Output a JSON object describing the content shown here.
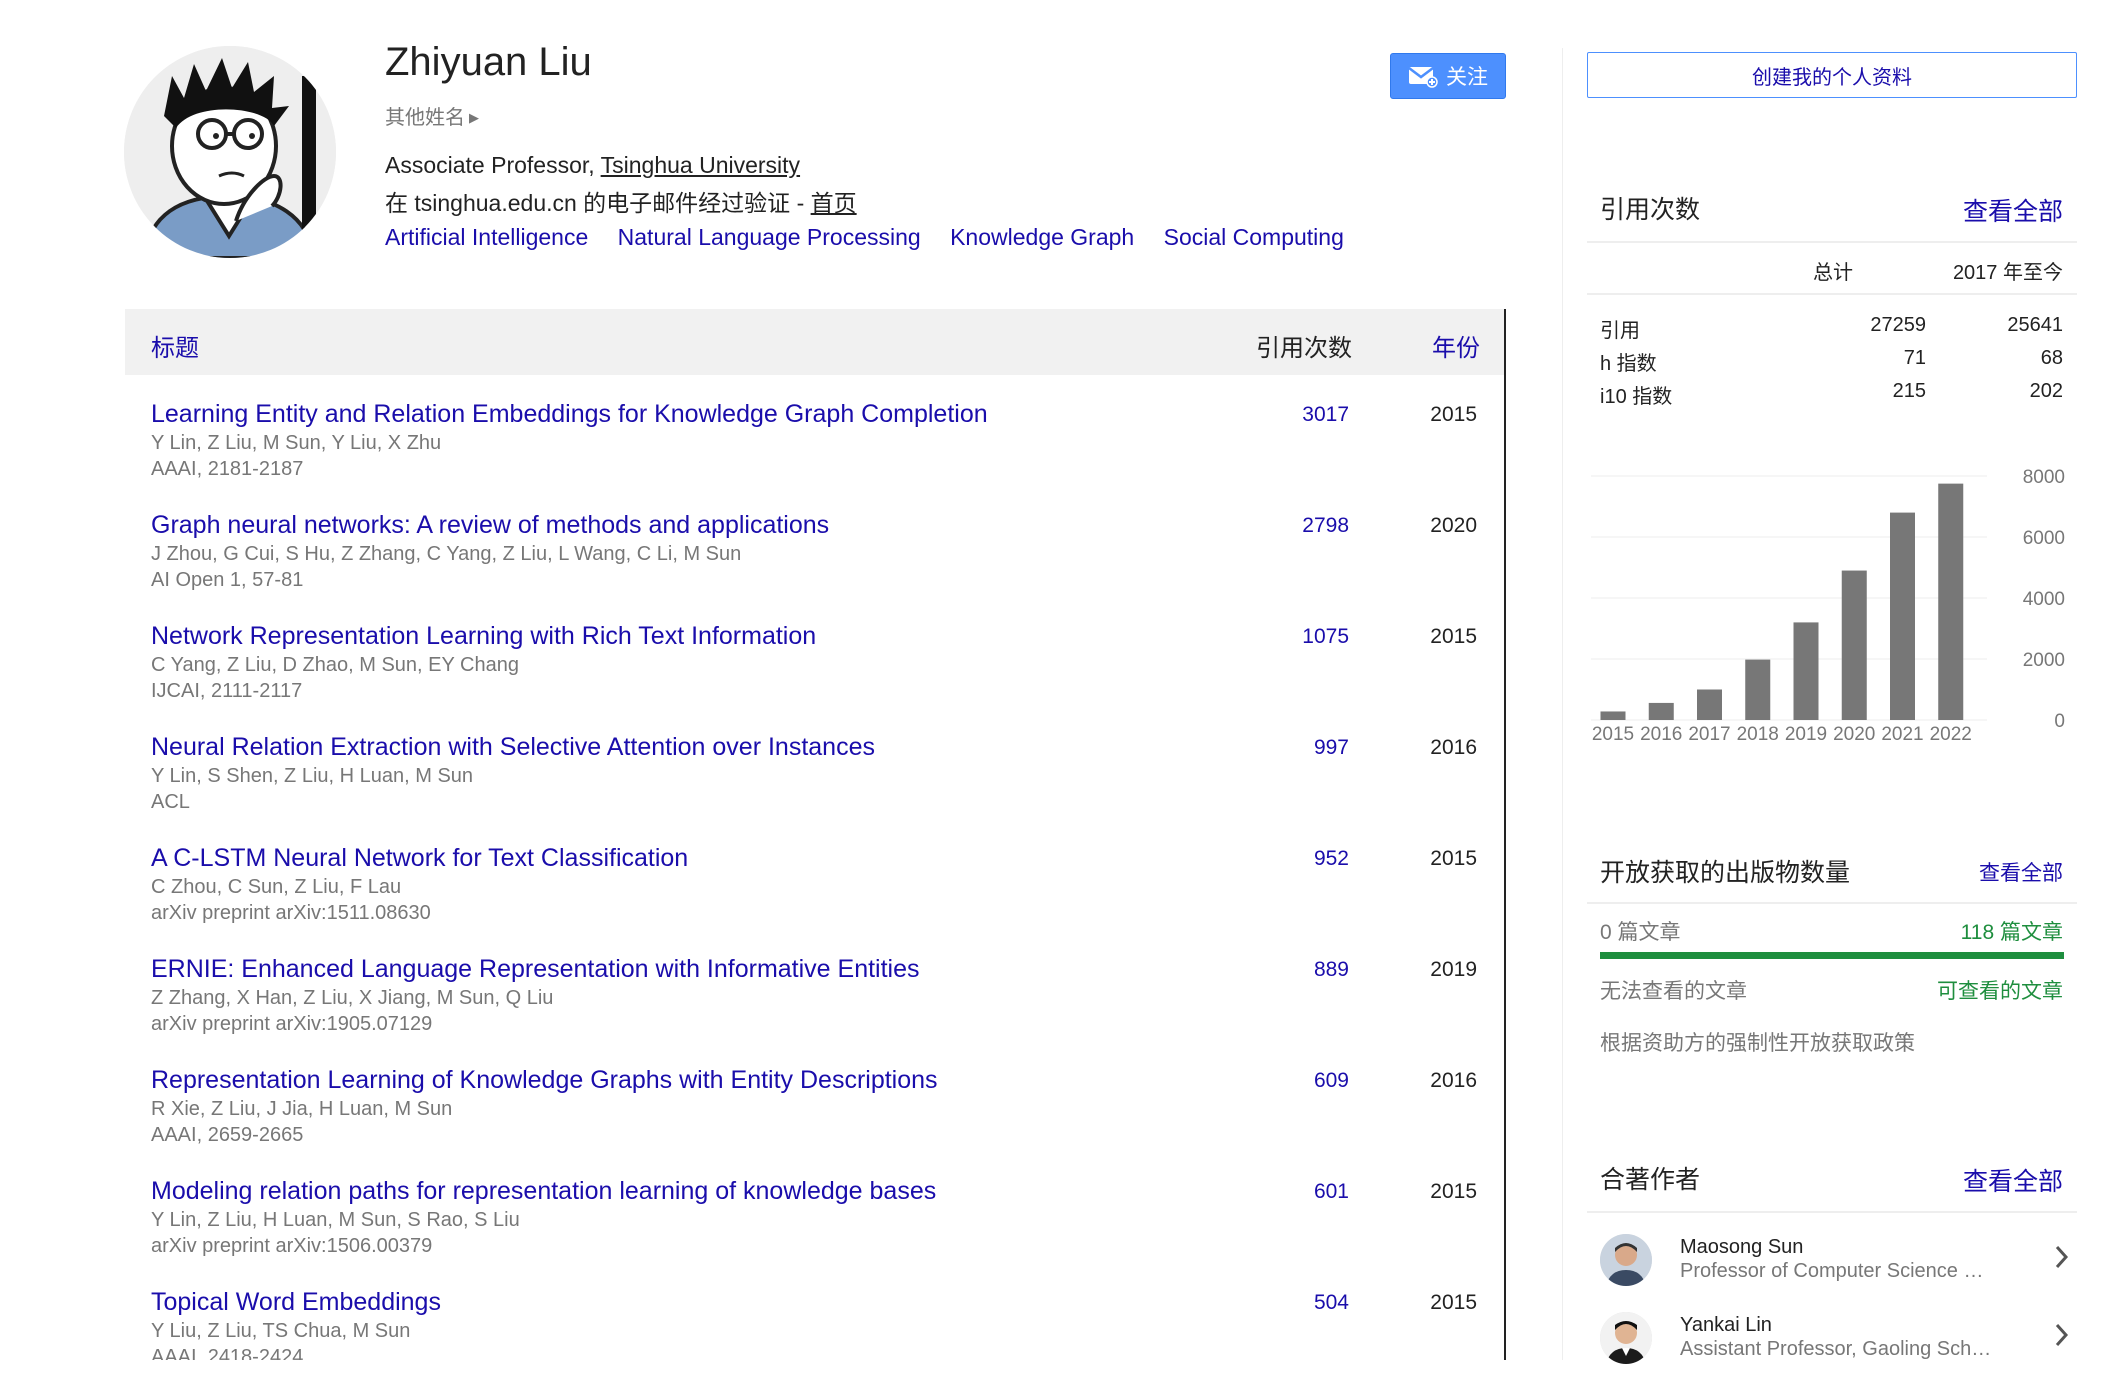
{
  "profile": {
    "name": "Zhiyuan Liu",
    "other_names": "其他姓名",
    "affiliation_prefix": "Associate Professor, ",
    "affiliation_link": "Tsinghua University",
    "verified_text": "在 tsinghua.edu.cn 的电子邮件经过验证 - ",
    "homepage_link": "首页",
    "interests": [
      "Artificial Intelligence",
      "Natural Language Processing",
      "Knowledge Graph",
      "Social Computing"
    ],
    "follow_label": "关注"
  },
  "table": {
    "headers": {
      "title": "标题",
      "cited_by": "引用次数",
      "year": "年份"
    },
    "rows": [
      {
        "title": "Learning Entity and Relation Embeddings for Knowledge Graph Completion",
        "authors": "Y Lin, Z Liu, M Sun, Y Liu, X Zhu",
        "venue": "AAAI, 2181-2187",
        "cites": "3017",
        "year": "2015"
      },
      {
        "title": "Graph neural networks: A review of methods and applications",
        "authors": "J Zhou, G Cui, S Hu, Z Zhang, C Yang, Z Liu, L Wang, C Li, M Sun",
        "venue": "AI Open 1, 57-81",
        "cites": "2798",
        "year": "2020"
      },
      {
        "title": "Network Representation Learning with Rich Text Information",
        "authors": "C Yang, Z Liu, D Zhao, M Sun, EY Chang",
        "venue": "IJCAI, 2111-2117",
        "cites": "1075",
        "year": "2015"
      },
      {
        "title": "Neural Relation Extraction with Selective Attention over Instances",
        "authors": "Y Lin, S Shen, Z Liu, H Luan, M Sun",
        "venue": "ACL",
        "cites": "997",
        "year": "2016"
      },
      {
        "title": "A C-LSTM Neural Network for Text Classification",
        "authors": "C Zhou, C Sun, Z Liu, F Lau",
        "venue": "arXiv preprint arXiv:1511.08630",
        "cites": "952",
        "year": "2015"
      },
      {
        "title": "ERNIE: Enhanced Language Representation with Informative Entities",
        "authors": "Z Zhang, X Han, Z Liu, X Jiang, M Sun, Q Liu",
        "venue": "arXiv preprint arXiv:1905.07129",
        "cites": "889",
        "year": "2019"
      },
      {
        "title": "Representation Learning of Knowledge Graphs with Entity Descriptions",
        "authors": "R Xie, Z Liu, J Jia, H Luan, M Sun",
        "venue": "AAAI, 2659-2665",
        "cites": "609",
        "year": "2016"
      },
      {
        "title": "Modeling relation paths for representation learning of knowledge bases",
        "authors": "Y Lin, Z Liu, H Luan, M Sun, S Rao, S Liu",
        "venue": "arXiv preprint arXiv:1506.00379",
        "cites": "601",
        "year": "2015"
      },
      {
        "title": "Topical Word Embeddings",
        "authors": "Y Liu, Z Liu, TS Chua, M Sun",
        "venue": "AAAI, 2418-2424",
        "cites": "504",
        "year": "2015"
      }
    ]
  },
  "sidebar": {
    "create_profile": "创建我的个人资料",
    "citations": {
      "title": "引用次数",
      "view_all": "查看全部",
      "col_total": "总计",
      "col_since": "2017 年至今",
      "metrics": [
        {
          "label": "引用",
          "total": "27259",
          "since": "25641"
        },
        {
          "label": "h 指数",
          "total": "71",
          "since": "68"
        },
        {
          "label": "i10 指数",
          "total": "215",
          "since": "202"
        }
      ]
    },
    "open_access": {
      "title": "开放获取的出版物数量",
      "view_all": "查看全部",
      "unavailable_count": "0 篇文章",
      "available_count": "118 篇文章",
      "unavailable_label": "无法查看的文章",
      "available_label": "可查看的文章",
      "mandates_note": "根据资助方的强制性开放获取政策",
      "available_fraction": 1.0,
      "bar_color": "#1e8e3e"
    },
    "coauthors": {
      "title": "合著作者",
      "view_all": "查看全部",
      "items": [
        {
          "name": "Maosong Sun",
          "affiliation": "Professor of Computer Science …"
        },
        {
          "name": "Yankai Lin",
          "affiliation": "Assistant Professor, Gaoling Sch…"
        }
      ]
    }
  },
  "chart_data": {
    "type": "bar",
    "categories": [
      "2015",
      "2016",
      "2017",
      "2018",
      "2019",
      "2020",
      "2021",
      "2022"
    ],
    "values": [
      280,
      560,
      1000,
      1980,
      3200,
      4900,
      6800,
      7750
    ],
    "yticks": [
      "0",
      "2000",
      "4000",
      "6000",
      "8000"
    ],
    "ylim": [
      0,
      8000
    ],
    "bar_color": "#777777",
    "grid": true
  }
}
